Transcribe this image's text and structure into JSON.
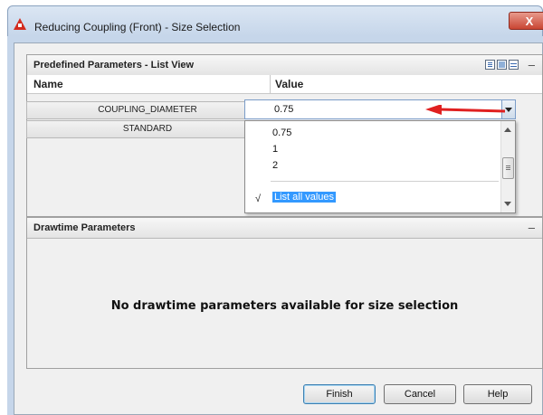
{
  "window": {
    "title": "Reducing Coupling (Front) - Size Selection",
    "close_label": "X"
  },
  "predefined_panel": {
    "title": "Predefined Parameters - List View",
    "collapse_label": "–",
    "columns": {
      "name": "Name",
      "value": "Value"
    },
    "rows": [
      {
        "name": "COUPLING_DIAMETER",
        "value": "0.75"
      },
      {
        "name": "STANDARD",
        "value": ""
      }
    ]
  },
  "dropdown": {
    "options": [
      "0.75",
      "1",
      "2"
    ],
    "check_mark": "√",
    "list_all_label": "List all values"
  },
  "drawtime_panel": {
    "title": "Drawtime Parameters",
    "collapse_label": "–",
    "empty_message": "No drawtime parameters available for size selection"
  },
  "buttons": {
    "finish": "Finish",
    "cancel": "Cancel",
    "help": "Help"
  },
  "colors": {
    "annotation_arrow": "#e02020",
    "selection_highlight": "#3399ff",
    "app_icon": "#d32b1e"
  }
}
